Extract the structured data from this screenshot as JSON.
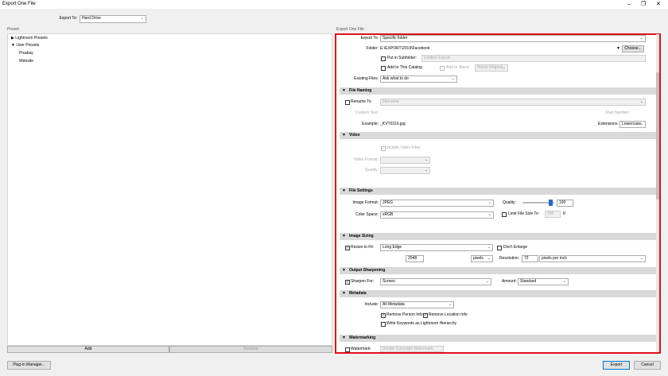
{
  "window": {
    "title": "Export One File",
    "controls": [
      "minimize-icon",
      "maximize-icon",
      "close-icon"
    ]
  },
  "header": {
    "export_to_label": "Export To:",
    "export_to_value": "Hard Drive"
  },
  "left": {
    "preset_label": "Preset:",
    "presets": [
      {
        "label": "Lightroom Presets",
        "expanded": false
      },
      {
        "label": "User Presets",
        "expanded": true,
        "children": [
          "Pixabay",
          "Website"
        ]
      }
    ],
    "add_label": "Add",
    "remove_label": "Remove"
  },
  "right": {
    "panel_label": "Export One File",
    "location": {
      "export_to_label": "Export To:",
      "export_to_value": "Specific folder",
      "folder_label": "Folder:",
      "folder_value": "E:\\EXPORT\\2019\\Facebook",
      "choose_label": "Choose...",
      "subfolder_label": "Put in Subfolder:",
      "subfolder_value": "Untitled Export",
      "catalog_label": "Add to This Catalog",
      "stack_label": "Add to Stack:",
      "stack_value": "Below Original",
      "existing_label": "Existing Files:",
      "existing_value": "Ask what to do"
    },
    "file_naming": {
      "title": "File Naming",
      "rename_label": "Rename To:",
      "rename_value": "Filename",
      "custom_text_label": "Custom Text:",
      "start_number_label": "Start Number:",
      "example_label": "Example:",
      "example_value": "_KVT0316.jpg",
      "extensions_label": "Extensions:",
      "extensions_value": "Lowercase"
    },
    "video": {
      "title": "Video",
      "include_label": "Include Video Files:",
      "format_label": "Video Format:",
      "quality_label": "Quality:"
    },
    "file_settings": {
      "title": "File Settings",
      "format_label": "Image Format:",
      "format_value": "JPEG",
      "quality_label": "Quality:",
      "quality_value": "100",
      "quality_fraction": 0.85,
      "color_space_label": "Color Space:",
      "color_space_value": "sRGB",
      "limit_label": "Limit File Size To:",
      "limit_value": "100",
      "limit_unit": "K"
    },
    "image_sizing": {
      "title": "Image Sizing",
      "resize_label": "Resize to Fit:",
      "resize_value": "Long Edge",
      "enlarge_label": "Don't Enlarge",
      "size_value": "2048",
      "unit_value": "pixels",
      "resolution_label": "Resolution:",
      "resolution_value": "72",
      "resolution_unit": "pixels per inch"
    },
    "output_sharpening": {
      "title": "Output Sharpening",
      "sharpen_label": "Sharpen For:",
      "sharpen_value": "Screen",
      "amount_label": "Amount:",
      "amount_value": "Standard"
    },
    "metadata": {
      "title": "Metadata",
      "include_label": "Include:",
      "include_value": "All Metadata",
      "person_label": "Remove Person Info",
      "location_label": "Remove Location Info",
      "keywords_label": "Write Keywords as Lightroom Hierarchy"
    },
    "watermarking": {
      "title": "Watermarking",
      "watermark_label": "Watermark:",
      "watermark_value": "Simple Copyright Watermark"
    }
  },
  "footer": {
    "plugin_label": "Plug-in Manager...",
    "export_label": "Export",
    "cancel_label": "Cancel"
  },
  "colors": {
    "highlight_border": "#e0101a",
    "slider_knob": "#2a68c8"
  }
}
